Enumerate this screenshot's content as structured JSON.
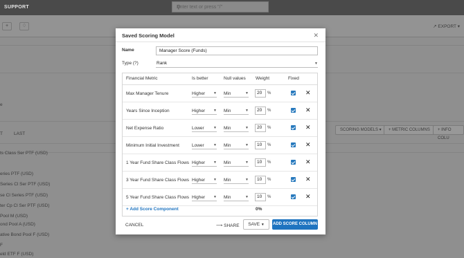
{
  "app": {
    "brand": "SUPPORT",
    "search_placeholder": "Enter text or press \"/\"",
    "export_label": "EXPORT",
    "tabs": [
      "T",
      "LAST"
    ],
    "toolbar_buttons": [
      "SCORING MODELS",
      "+ METRIC COLUMNS",
      "+ INFO COLU"
    ],
    "fund_rows": [
      "ts Class Ser PTF (USD)",
      "eries PTF (USD)",
      "Series Cl Ser PTF (USD)",
      "se Cl Series PTF (USD)",
      "ter Cp Cl Ser PTF (USD)",
      "Pool M (USD)",
      "ond Pool A (USD)",
      "ative Bond Pool F (USD)",
      "F",
      "eld ETF F (USD)"
    ],
    "side_letter": "e"
  },
  "modal": {
    "title": "Saved Scoring Model",
    "name_label": "Name",
    "name_value": "Manager Score (Funds)",
    "type_label": "Type (?)",
    "type_value": "Rank",
    "columns": {
      "metric": "Financial Metric",
      "better": "Is better",
      "null": "Null values",
      "weight": "Weight",
      "fixed": "Fixed"
    },
    "rows": [
      {
        "metric": "Max Manager Tenure",
        "better": "Higher",
        "null": "Min",
        "weight": "20",
        "pct": "%"
      },
      {
        "metric": "Years Since Inception",
        "better": "Higher",
        "null": "Min",
        "weight": "20",
        "pct": "%"
      },
      {
        "metric": "Net Expense Ratio",
        "better": "Lower",
        "null": "Min",
        "weight": "20",
        "pct": "%"
      },
      {
        "metric": "Minimum Initial Investment",
        "better": "Lower",
        "null": "Min",
        "weight": "10",
        "pct": "%"
      },
      {
        "metric": "1 Year Fund Share Class Flows",
        "better": "Higher",
        "null": "Min",
        "weight": "10",
        "pct": "%"
      },
      {
        "metric": "3 Year Fund Share Class Flows",
        "better": "Higher",
        "null": "Min",
        "weight": "10",
        "pct": "%"
      },
      {
        "metric": "5 Year Fund Share Class Flows",
        "better": "Higher",
        "null": "Min",
        "weight": "10",
        "pct": "%"
      }
    ],
    "add_component": "+ Add Score Component",
    "total_weight": "0%",
    "cancel": "CANCEL",
    "share": "SHARE",
    "save": "SAVE",
    "add_score_column": "ADD SCORE COLUMN"
  },
  "colors": {
    "accent": "#1f74c0",
    "overlay": "#8f8f8f",
    "topbar": "#4a4a4a"
  }
}
